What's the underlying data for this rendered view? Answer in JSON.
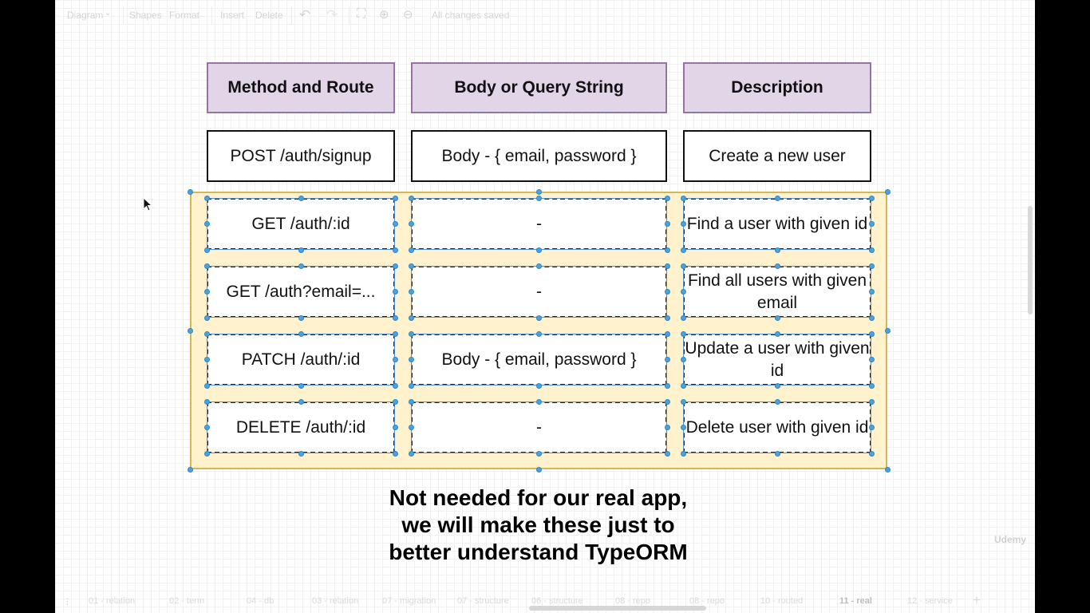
{
  "toolbar": {
    "diagram_label": "Diagram",
    "shapes_label": "Shapes",
    "format_label": "Format",
    "insert_label": "Insert",
    "delete_label": "Delete",
    "status": "All changes saved"
  },
  "table": {
    "headers": [
      "Method and Route",
      "Body or Query String",
      "Description"
    ],
    "rows": [
      {
        "route": "POST /auth/signup",
        "body": "Body - { email, password }",
        "description": "Create a new user"
      },
      {
        "route": "GET /auth/:id",
        "body": "-",
        "description": "Find a user with given id"
      },
      {
        "route": "GET /auth?email=...",
        "body": "-",
        "description": "Find all users with given email"
      },
      {
        "route": "PATCH /auth/:id",
        "body": "Body - { email, password }",
        "description": "Update a user with given id"
      },
      {
        "route": "DELETE /auth/:id",
        "body": "-",
        "description": "Delete user with given id"
      }
    ]
  },
  "note": {
    "line1": "Not needed for our real app,",
    "line2": "we will make these just to",
    "line3": "better understand TypeORM"
  },
  "tabs": [
    {
      "label": "01 - relation"
    },
    {
      "label": "02 - term"
    },
    {
      "label": "04 - db"
    },
    {
      "label": "03 - relation"
    },
    {
      "label": "07 - migration"
    },
    {
      "label": "07 - structure"
    },
    {
      "label": "06 - structure"
    },
    {
      "label": "08 - repo"
    },
    {
      "label": "08 - repo"
    },
    {
      "label": "10 - routed"
    },
    {
      "label": "11 - real"
    },
    {
      "label": "12 - service"
    }
  ],
  "watermark": "Udemy",
  "colors": {
    "header_fill": "#e1d5e7",
    "header_stroke": "#9673a6",
    "group_fill": "#fff2cc",
    "group_stroke": "#d6b656",
    "handle": "#4aa3df"
  }
}
